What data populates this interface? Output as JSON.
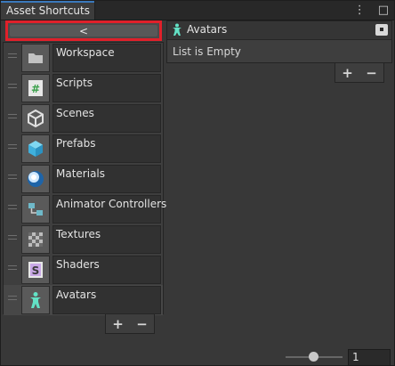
{
  "window": {
    "tab_title": "Asset Shortcuts",
    "menu_icon": "kebab-icon",
    "maximize_icon": "square-icon"
  },
  "left": {
    "back_label": "<",
    "items": [
      {
        "label": "Workspace",
        "icon": "folder-icon"
      },
      {
        "label": "Scripts",
        "icon": "csharp-script-icon"
      },
      {
        "label": "Scenes",
        "icon": "unity-scene-icon"
      },
      {
        "label": "Prefabs",
        "icon": "prefab-cube-icon"
      },
      {
        "label": "Materials",
        "icon": "material-sphere-icon"
      },
      {
        "label": "Animator Controllers",
        "icon": "animator-controller-icon"
      },
      {
        "label": "Textures",
        "icon": "texture-icon"
      },
      {
        "label": "Shaders",
        "icon": "shader-icon"
      },
      {
        "label": "Avatars",
        "icon": "avatar-figure-icon",
        "selected": true
      }
    ],
    "add_label": "+",
    "remove_label": "−"
  },
  "right": {
    "header_title": "Avatars",
    "empty_text": "List is Empty",
    "add_label": "+",
    "remove_label": "−"
  },
  "footer": {
    "zoom_value": "1"
  },
  "colors": {
    "accent": "#3a79bb",
    "highlight": "#e0202a"
  }
}
